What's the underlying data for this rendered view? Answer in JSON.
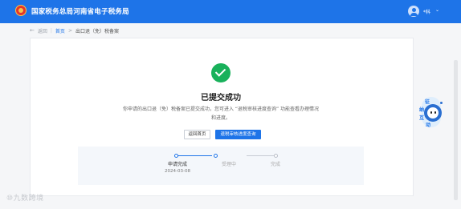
{
  "header": {
    "title": "国家税务总局河南省电子税务局",
    "user_name": "*科",
    "chevron": "⌄"
  },
  "breadcrumb": {
    "back_arrow": "←",
    "back_label": "返回",
    "separator": "|",
    "home_label": "首页",
    "slash": ">",
    "current": "出口退（免）税备案"
  },
  "result": {
    "title": "已提交成功",
    "description_line1": "你申请的出口退（免）税备案已提交成功，您可进入 “退税审核进度查询” 功能查看办理情况",
    "description_line2": "和进度。"
  },
  "actions": {
    "back_home_label": "返回首页",
    "query_label": "退税审核进度查询"
  },
  "progress": {
    "steps": [
      {
        "label": "申请完成",
        "date": "2024-03-08",
        "active": true
      },
      {
        "label": "受理中",
        "date": "",
        "active": false
      },
      {
        "label": "完成",
        "date": "",
        "active": false
      }
    ]
  },
  "helper": {
    "chars": [
      "征",
      "纳",
      "互",
      "动"
    ]
  },
  "watermark": {
    "text": "⑩九数跨境"
  },
  "colors": {
    "primary": "#1e74e8",
    "success": "#19b15b"
  }
}
